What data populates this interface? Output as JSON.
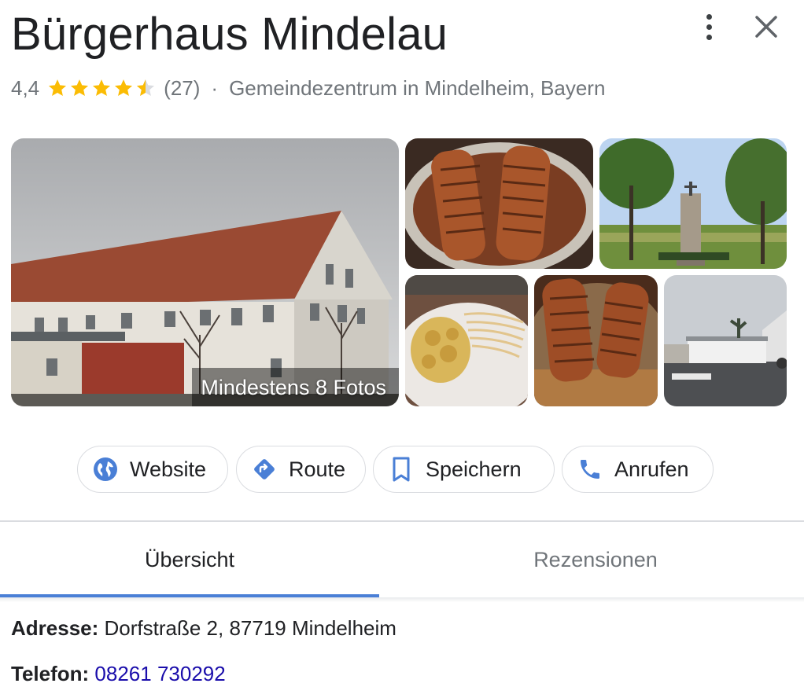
{
  "header": {
    "title": "Bürgerhaus Mindelau",
    "rating": "4,4",
    "rating_value": 4.4,
    "review_count": "(27)",
    "separator": "·",
    "category": "Gemeindezentrum in Mindelheim, Bayern",
    "star_color": "#fbbc04",
    "more_icon": "more-vert-icon",
    "close_icon": "close-icon"
  },
  "photos": {
    "caption": "Mindestens 8 Fotos"
  },
  "actions": [
    {
      "label": "Website",
      "icon": "globe-icon",
      "color": "#4285f4"
    },
    {
      "label": "Route",
      "icon": "directions-icon",
      "color": "#4285f4"
    },
    {
      "label": "Speichern",
      "icon": "bookmark-icon",
      "color": "#4285f4"
    },
    {
      "label": "Anrufen",
      "icon": "phone-icon",
      "color": "#4285f4"
    }
  ],
  "tabs": [
    {
      "label": "Übersicht",
      "active": true
    },
    {
      "label": "Rezensionen",
      "active": false
    }
  ],
  "details": {
    "address_label": "Adresse:",
    "address_value": "Dorfstraße 2, 87719 Mindelheim",
    "phone_label": "Telefon:",
    "phone_value": "08261 730292"
  },
  "colors": {
    "accent": "#4a7fd6",
    "link": "#1a0dab",
    "muted_text": "#70757a"
  }
}
